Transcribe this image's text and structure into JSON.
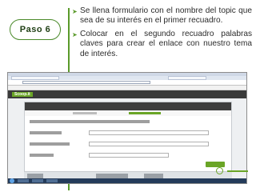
{
  "slide": {
    "step_label": "Paso  6",
    "bullets": [
      "Se llena formulario con el nombre  del topic que sea de su interés en el primer recuadro.",
      "Colocar en el segundo  recuadro palabras claves para crear el enlace con nuestro tema de interés."
    ],
    "page_number": "",
    "accent_color": "#5a9a2a",
    "bullet_icon": "arrow-bullet-icon"
  },
  "screenshot": {
    "app_logo": "Scoop.it"
  }
}
